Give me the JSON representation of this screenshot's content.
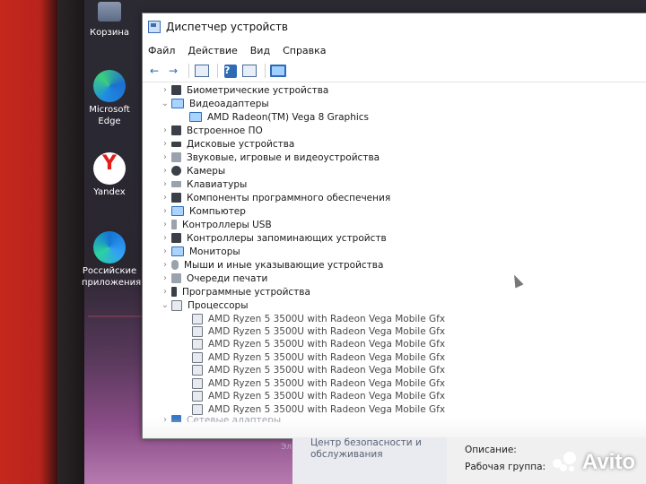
{
  "desktop": {
    "icons": [
      {
        "label": "Корзина"
      },
      {
        "label": "Microsoft Edge"
      },
      {
        "label": "Yandex"
      },
      {
        "label": "Российские приложения"
      }
    ]
  },
  "window": {
    "title": "Диспетчер устройств",
    "menu": [
      "Файл",
      "Действие",
      "Вид",
      "Справка"
    ],
    "toolbar": [
      "back-icon",
      "forward-icon",
      "properties-icon",
      "help-icon",
      "update-driver-icon",
      "monitor-icon"
    ],
    "tree": [
      {
        "label": "Биометрические устройства",
        "expanded": false
      },
      {
        "label": "Видеоадаптеры",
        "expanded": true,
        "children": [
          "AMD Radeon(TM) Vega 8 Graphics"
        ]
      },
      {
        "label": "Встроенное ПО",
        "expanded": false
      },
      {
        "label": "Дисковые устройства",
        "expanded": false
      },
      {
        "label": "Звуковые, игровые и видеоустройства",
        "expanded": false
      },
      {
        "label": "Камеры",
        "expanded": false
      },
      {
        "label": "Клавиатуры",
        "expanded": false
      },
      {
        "label": "Компоненты программного обеспечения",
        "expanded": false
      },
      {
        "label": "Компьютер",
        "expanded": false
      },
      {
        "label": "Контроллеры USB",
        "expanded": false
      },
      {
        "label": "Контроллеры запоминающих устройств",
        "expanded": false
      },
      {
        "label": "Мониторы",
        "expanded": false
      },
      {
        "label": "Мыши и иные указывающие устройства",
        "expanded": false
      },
      {
        "label": "Очереди печати",
        "expanded": false
      },
      {
        "label": "Программные устройства",
        "expanded": false
      },
      {
        "label": "Процессоры",
        "expanded": true,
        "children": [
          "AMD Ryzen 5 3500U with Radeon Vega Mobile Gfx",
          "AMD Ryzen 5 3500U with Radeon Vega Mobile Gfx",
          "AMD Ryzen 5 3500U with Radeon Vega Mobile Gfx",
          "AMD Ryzen 5 3500U with Radeon Vega Mobile Gfx",
          "AMD Ryzen 5 3500U with Radeon Vega Mobile Gfx",
          "AMD Ryzen 5 3500U with Radeon Vega Mobile Gfx",
          "AMD Ryzen 5 3500U with Radeon Vega Mobile Gfx",
          "AMD Ryzen 5 3500U with Radeon Vega Mobile Gfx"
        ]
      },
      {
        "label": "Сетевые адаптеры",
        "expanded": false
      }
    ]
  },
  "back_window": {
    "security_center": "Центр безопасности и обслуживания",
    "description_label": "Описание:",
    "workgroup_label": "Рабочая группа:",
    "partial_text": "Эл"
  },
  "watermark": "Avito"
}
